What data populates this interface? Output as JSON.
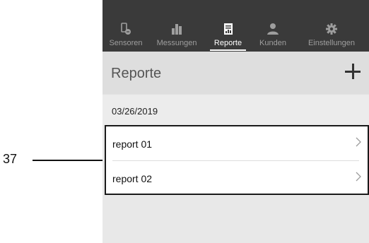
{
  "callout": {
    "number": "37"
  },
  "navbar": {
    "items": [
      {
        "label": "Sensoren",
        "icon": "sensor-icon",
        "active": false
      },
      {
        "label": "Messungen",
        "icon": "bar-chart-icon",
        "active": false
      },
      {
        "label": "Reporte",
        "icon": "report-document-icon",
        "active": true
      },
      {
        "label": "Kunden",
        "icon": "user-icon",
        "active": false
      },
      {
        "label": "Einstellungen",
        "icon": "gear-icon",
        "active": false
      }
    ]
  },
  "header": {
    "title": "Reporte",
    "add_icon": "plus-icon"
  },
  "date_group": "03/26/2019",
  "reports": [
    {
      "label": "report 01",
      "icon": "chevron-right-icon"
    },
    {
      "label": "report 02",
      "icon": "chevron-right-icon"
    }
  ],
  "colors": {
    "navbar_bg": "#3a3a3a",
    "nav_inactive": "#9e9e9e",
    "nav_active": "#ffffff",
    "screen_bg": "#e8e8e8",
    "highlight_border": "#1a1a1a"
  }
}
